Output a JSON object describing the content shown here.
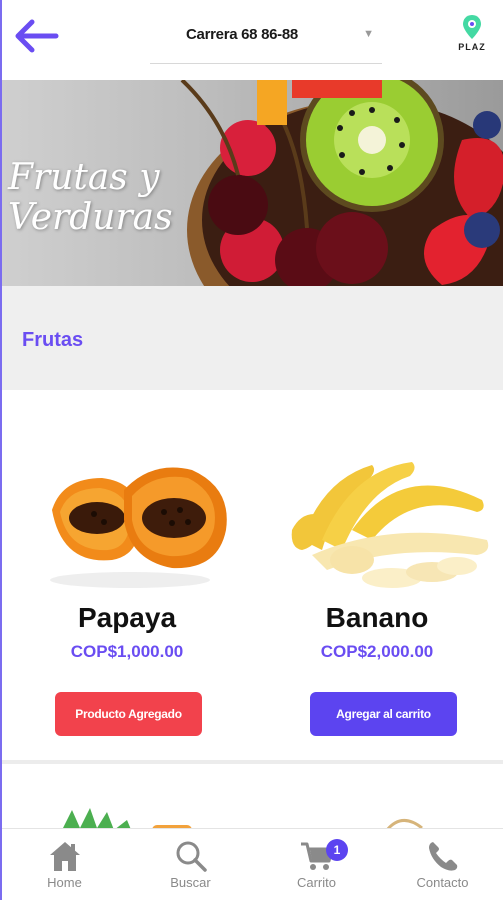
{
  "header": {
    "back_icon": "arrow-left-icon",
    "address": "Carrera 68 86-88",
    "caret_icon": "caret-down-icon",
    "logo_text": "PLAZ"
  },
  "banner": {
    "title_line1": "Frutas y",
    "title_line2": "Verduras"
  },
  "category": {
    "title": "Frutas"
  },
  "products": [
    {
      "name": "Papaya",
      "price": "COP$1,000.00",
      "button_label": "Producto Agregado",
      "button_color": "#f2424c"
    },
    {
      "name": "Banano",
      "price": "COP$2,000.00",
      "button_label": "Agregar al carrito",
      "button_color": "#5c44f0"
    }
  ],
  "bottom_nav": {
    "items": [
      {
        "label": "Home",
        "icon": "home-icon"
      },
      {
        "label": "Buscar",
        "icon": "search-icon"
      },
      {
        "label": "Carrito",
        "icon": "cart-icon",
        "badge": "1"
      },
      {
        "label": "Contacto",
        "icon": "phone-icon"
      }
    ]
  },
  "colors": {
    "accent": "#6a4df2",
    "button_primary": "#5c44f0",
    "button_added": "#f2424c"
  }
}
